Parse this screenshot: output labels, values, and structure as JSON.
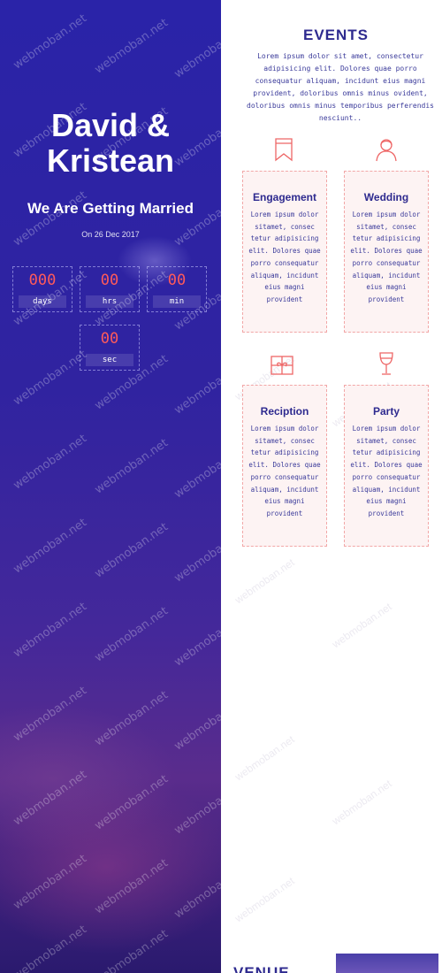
{
  "hero": {
    "name_line1": "David &",
    "name_line2": "Kristean",
    "tagline": "We Are Getting Married",
    "date": "On 26 Dec 2017",
    "countdown": [
      {
        "value": "000",
        "label": "days"
      },
      {
        "value": "00",
        "label": "hrs"
      },
      {
        "value": "00",
        "label": "min"
      },
      {
        "value": "00",
        "label": "sec"
      }
    ],
    "watermark": "webmoban.net"
  },
  "events": {
    "title": "EVENTS",
    "intro": "Lorem ipsum dolor sit amet, consectetur adipisicing elit. Dolores quae porro consequatur aliquam, incidunt eius magni provident, doloribus omnis minus ovident, doloribus omnis minus temporibus perferendis nesciunt..",
    "cards": [
      {
        "title": "Engagement",
        "icon": "bookmark-icon",
        "text": "Lorem ipsum dolor sitamet, consec tetur adipisicing elit. Dolores quae porro consequatur aliquam, incidunt eius magni provident"
      },
      {
        "title": "Wedding",
        "icon": "bride-icon",
        "text": "Lorem ipsum dolor sitamet, consec tetur adipisicing elit. Dolores quae porro consequatur aliquam, incidunt eius magni provident"
      },
      {
        "title": "Reciption",
        "icon": "gift-icon",
        "text": "Lorem ipsum dolor sitamet, consec tetur adipisicing elit. Dolores quae porro consequatur aliquam, incidunt eius magni provident"
      },
      {
        "title": "Party",
        "icon": "wine-glass-icon",
        "text": "Lorem ipsum dolor sitamet, consec tetur adipisicing elit. Dolores quae porro consequatur aliquam, incidunt eius magni provident"
      }
    ]
  },
  "venue": {
    "title": "VENUE"
  },
  "colors": {
    "accent": "#2e2a8f",
    "countdown": "#ff5a5a",
    "card_border": "#f2a7a7",
    "card_bg": "#fdf3f3"
  }
}
